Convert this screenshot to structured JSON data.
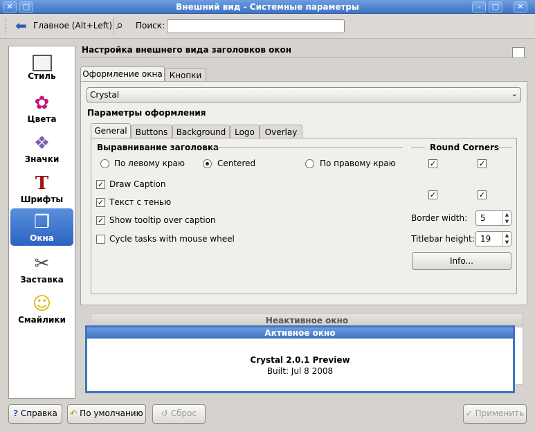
{
  "window": {
    "title": "Внешний вид - Системные параметры",
    "accent": "#3f72c2"
  },
  "toolbar": {
    "home_label": "Главное (Alt+Left)",
    "search_label": "Поиск:",
    "search_value": ""
  },
  "sidebar": {
    "items": [
      {
        "label": "Стиль",
        "icon": "style-icon"
      },
      {
        "label": "Цвета",
        "icon": "colors-icon"
      },
      {
        "label": "Значки",
        "icon": "icons-icon"
      },
      {
        "label": "Шрифты",
        "icon": "fonts-icon"
      },
      {
        "label": "Окна",
        "icon": "windows-icon"
      },
      {
        "label": "Заставка",
        "icon": "screensaver-icon"
      },
      {
        "label": "Смайлики",
        "icon": "emoticons-icon"
      }
    ],
    "selected": "Окна"
  },
  "main": {
    "title": "Настройка внешнего вида заголовков окон",
    "tabs": [
      "Оформление окна",
      "Кнопки"
    ],
    "decoration": "Crystal",
    "params_title": "Параметры оформления",
    "subtabs": [
      "General",
      "Buttons",
      "Background",
      "Logo",
      "Overlay"
    ],
    "alignment_title": "Выравнивание заголовка",
    "align_left": "По левому краю",
    "align_center": "Centered",
    "align_right": "По правому краю",
    "round_corners": "Round Corners",
    "draw_caption": "Draw Caption",
    "text_shadow": "Текст с тенью",
    "show_tooltip": "Show tooltip over caption",
    "cycle_tasks": "Cycle tasks with mouse wheel",
    "border_width_label": "Border width:",
    "border_width": "5",
    "titlebar_height_label": "Titlebar height:",
    "titlebar_height": "19",
    "info_button": "Info..."
  },
  "preview": {
    "inactive_title": "Неактивное окно",
    "active_title": "Активное окно",
    "text1": "Crystal 2.0.1 Preview",
    "text2": "Built: Jul 8 2008"
  },
  "footer": {
    "help": "Справка",
    "defaults": "По умолчанию",
    "reset": "Сброс",
    "apply": "Применить"
  }
}
